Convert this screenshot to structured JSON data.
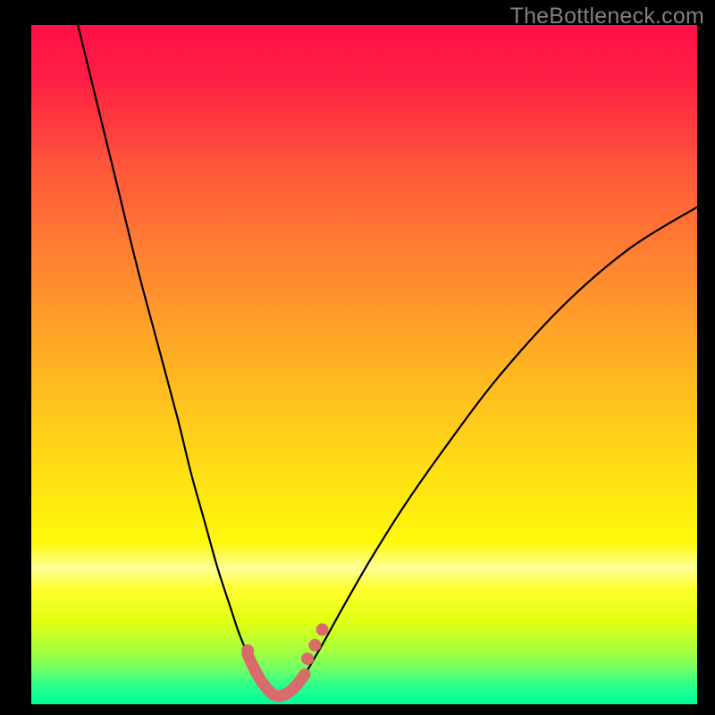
{
  "watermark": "TheBottleneck.com",
  "colors": {
    "curve": "#000000",
    "highlight": "#d96b6b",
    "dot": "#d96b6b"
  },
  "chart_data": {
    "type": "line",
    "title": "",
    "xlabel": "",
    "ylabel": "",
    "xlim": [
      0,
      100
    ],
    "ylim": [
      0,
      100
    ],
    "note": "Axes are unlabeled; values are relative 0–100. Lower y = closer to bottom (better / green zone). Curve is a V-shaped bottleneck profile with minimum near x≈37.",
    "series": [
      {
        "name": "bottleneck-curve",
        "x": [
          7,
          10,
          13,
          16,
          19,
          22,
          24,
          26,
          28,
          30,
          31,
          32,
          33,
          34,
          35,
          36,
          37,
          38,
          39,
          40,
          41,
          42,
          44,
          47,
          51,
          56,
          62,
          70,
          80,
          90,
          100
        ],
        "y": [
          100,
          88,
          76,
          64,
          53,
          42,
          34,
          27,
          20,
          14,
          11,
          8.5,
          6.2,
          4.3,
          2.8,
          1.7,
          1.2,
          1.4,
          2.0,
          3.0,
          4.3,
          5.9,
          9.3,
          14.6,
          21.4,
          29.2,
          37.6,
          48.0,
          58.8,
          67.2,
          73.2
        ]
      }
    ],
    "highlight_range_x": [
      32.5,
      41.0
    ],
    "dots": [
      {
        "x": 32.5,
        "y": 7.9
      },
      {
        "x": 41.5,
        "y": 6.7
      },
      {
        "x": 42.6,
        "y": 8.7
      },
      {
        "x": 43.7,
        "y": 11.0
      }
    ]
  }
}
